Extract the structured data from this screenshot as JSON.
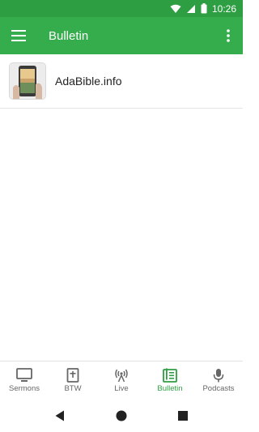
{
  "status_bar": {
    "time": "10:26"
  },
  "app_bar": {
    "title": "Bulletin"
  },
  "list": [
    {
      "label": "AdaBible.info"
    }
  ],
  "bottom_nav": {
    "items": [
      {
        "label": "Sermons",
        "icon": "tv-icon"
      },
      {
        "label": "BTW",
        "icon": "bible-icon"
      },
      {
        "label": "Live",
        "icon": "broadcast-icon"
      },
      {
        "label": "Bulletin",
        "icon": "bulletin-icon"
      },
      {
        "label": "Podcasts",
        "icon": "microphone-icon"
      }
    ],
    "active": "Bulletin",
    "active_color": "#2e9e42",
    "inactive_color": "#666666"
  },
  "colors": {
    "app_bar": "#35ad4d",
    "status_bar": "#2e9e42"
  }
}
